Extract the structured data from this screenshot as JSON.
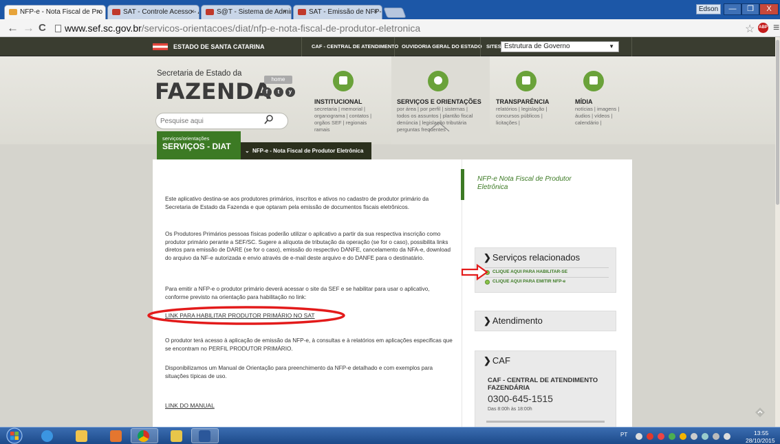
{
  "browser": {
    "tabs": [
      {
        "label": "NFP-e - Nota Fiscal de Pro",
        "active": true
      },
      {
        "label": "SAT - Controle Acesso - A",
        "active": false
      },
      {
        "label": "S@T - Sistema de Admini",
        "active": false
      },
      {
        "label": "SAT - Emissão de NFP-e p",
        "active": false
      }
    ],
    "tab_close": "×",
    "user": "Edson",
    "window_buttons": [
      "—",
      "❐",
      "X"
    ],
    "url_host": "www.sef.sc.gov.br",
    "url_path": "/servicos-orientacoes/diat/nfp-e-nota-fiscal-de-produtor-eletronica",
    "back": "←",
    "forward": "→",
    "reload": "C",
    "star": "☆",
    "adblock_label": "ABP",
    "menu": "≡"
  },
  "topnav": {
    "state": "ESTADO DE SANTA CATARINA",
    "caf": "CAF - CENTRAL DE ATENDIMENTO",
    "ouvidoria": "OUVIDORIA GERAL DO ESTADO",
    "sites_label": "SITES",
    "sites_value": "Estrutura de Governo",
    "sites_caret": "▼"
  },
  "header": {
    "secretaria": "Secretaria de Estado da",
    "fazenda": "FAZENDA",
    "home": "home",
    "social": [
      "f",
      "t",
      "y"
    ],
    "search_placeholder": "Pesquise aqui"
  },
  "menu": [
    {
      "title": "INSTITUCIONAL",
      "links": [
        "secretaria | memorial |",
        "organograma | contatos |",
        "orgãos SEF | regionais",
        "ramais"
      ]
    },
    {
      "title": "SERVIÇOS E ORIENTAÇÕES",
      "links": [
        "por área | por perfil | sistemas |",
        "todos os assuntos | plantão fiscal",
        "denúncia | legislação tributária",
        "perguntas frequentes"
      ]
    },
    {
      "title": "TRANSPARÊNCIA",
      "links": [
        "relatórios | legislação |",
        "concursos públicos |",
        "licitações |"
      ]
    },
    {
      "title": "MÍDIA",
      "links": [
        "notícias | imagens |",
        "áudios | vídeos |",
        "calendário |"
      ]
    }
  ],
  "section": {
    "small": "serviços/orientações",
    "big": "SERVIÇOS - DIAT",
    "crumb_icon": "⌄",
    "crumb": "NFP-e - Nota Fiscal de Produtor Eletrônica"
  },
  "content": {
    "p1": "Este aplicativo destina-se aos produtores primários, inscritos e ativos no cadastro de produtor primário da Secretaria de Estado da Fazenda e que optaram pela emissão de documentos fiscais eletrônicos.",
    "p2": "Os Produtores Primários pessoas físicas poderão utilizar o aplicativo a partir da sua respectiva inscrição como produtor primário perante a SEF/SC. Sugere a alíquota de tributação da operação (se for o caso), possibilita links diretos para emissão de DARE (se for o caso), emissão do respectivo DANFE, cancelamento da NFA-e, download do arquivo da NF-e autorizada e envio através de e-mail deste arquivo e do DANFE para o destinatário.",
    "p3": "Para emitir a NFP-e o produtor primário deverá acessar o site da SEF e se habilitar para usar o aplicativo, conforme previsto na orientação para habilitação no link:",
    "link_habilitar": "LINK PARA HABILITAR PRODUTOR PRIMÁRIO NO SAT",
    "p4": "O produtor terá acesso à aplicação de emissão da NFP-e, à consultas e à relatórios em aplicações especificas que se encontram no PERFIL PRODUTOR PRIMÁRIO.",
    "p5": "Disponibilizamos um Manual de Orientação para preenchimento da NFP-e detalhado e com exemplos para situações típicas de uso.",
    "link_manual": "LINK DO MANUAL"
  },
  "sidebar": {
    "title": "NFP-e Nota Fiscal de Produtor Eletrônica",
    "arrow": "❯",
    "servicos_head": "Serviços relacionados",
    "link1": "CLIQUE AQUI PARA HABILITAR-SE",
    "link2": "CLIQUE AQUI PARA EMITIR NFP-e",
    "atendimento_head": "Atendimento",
    "caf_head": "CAF",
    "caf_title": "CAF - CENTRAL DE ATENDIMENTO FAZENDÁRIA",
    "caf_phone": "0300-645-1515",
    "caf_hours": "Das 8:00h às 18:00h"
  },
  "taskbar": {
    "lang": "PT",
    "time": "13:55",
    "date": "28/10/2015"
  },
  "colors": {
    "accent_green": "#3c7a24",
    "chrome_blue": "#1c57a7",
    "annotation_red": "#e31b1b"
  }
}
